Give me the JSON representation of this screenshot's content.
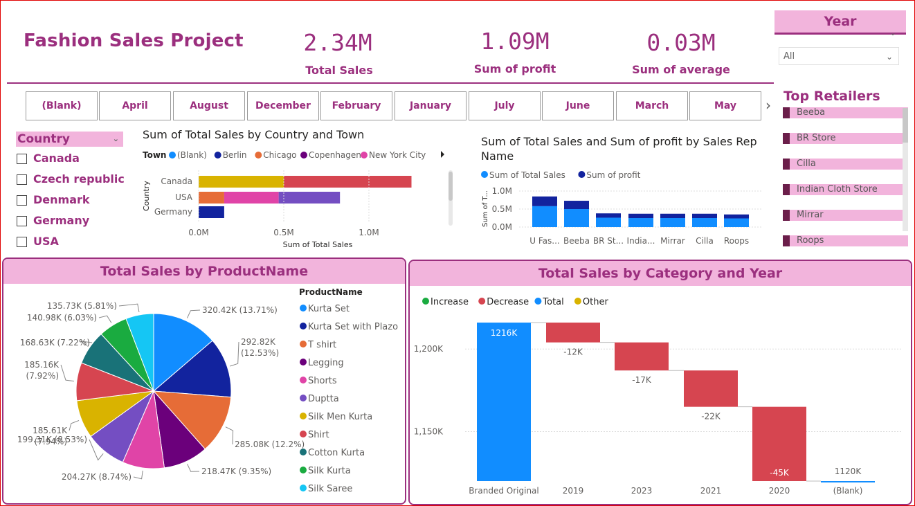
{
  "title": "Fashion Sales Project",
  "kpis": [
    {
      "value": "2.34M",
      "label": "Total Sales"
    },
    {
      "value": "1.09M",
      "label": "Sum of profit"
    },
    {
      "value": "0.03M",
      "label": "Sum of average"
    }
  ],
  "year_filter": {
    "label": "Year",
    "selected": "All"
  },
  "months": [
    "(Blank)",
    "April",
    "August",
    "December",
    "February",
    "January",
    "July",
    "June",
    "March",
    "May"
  ],
  "top_retailers": {
    "label": "Top Retailers",
    "items": [
      "Beeba",
      "BR Store",
      "Cilla",
      "Indian Cloth Store",
      "Mirrar",
      "Roops"
    ]
  },
  "country_filter": {
    "label": "Country",
    "items": [
      "Canada",
      "Czech republic",
      "Denmark",
      "Germany",
      "USA"
    ]
  },
  "colors": {
    "accent": "#9b2f7e",
    "header_bg": "#f2b4dc",
    "blue": "#118dff",
    "dark_blue": "#12239e",
    "orange": "#e66c37",
    "purple": "#6b007b",
    "pink": "#e044a7",
    "violet": "#744ec2",
    "gold": "#d9b300",
    "red": "#d64550",
    "teal": "#197278",
    "green": "#1aab40",
    "cyan": "#15c6f4"
  },
  "chart_data": [
    {
      "type": "bar",
      "orientation": "horizontal",
      "stacked": true,
      "title": "Sum of Total Sales by Country and Town",
      "legend_title": "Town",
      "legend": [
        {
          "name": "(Blank)",
          "color": "#118dff"
        },
        {
          "name": "Berlin",
          "color": "#12239e"
        },
        {
          "name": "Chicago",
          "color": "#e66c37"
        },
        {
          "name": "Copenhagen",
          "color": "#6b007b"
        },
        {
          "name": "New York City",
          "color": "#e044a7"
        }
      ],
      "categories": [
        "Canada",
        "USA",
        "Germany"
      ],
      "segments": [
        [
          {
            "value": 0.5,
            "color": "#d9b300"
          },
          {
            "value": 0.75,
            "color": "#d64550"
          }
        ],
        [
          {
            "value": 0.15,
            "color": "#e66c37"
          },
          {
            "value": 0.32,
            "color": "#e044a7"
          },
          {
            "value": 0.36,
            "color": "#744ec2"
          }
        ],
        [
          {
            "value": 0.15,
            "color": "#12239e"
          }
        ]
      ],
      "xlabel": "Sum of Total Sales",
      "ylabel": "Country",
      "xticks": [
        "0.0M",
        "0.5M",
        "1.0M"
      ],
      "xlim": [
        0,
        1.3
      ]
    },
    {
      "type": "bar",
      "stacked": true,
      "title": "Sum of Total Sales and Sum of profit by Sales Rep Name",
      "legend": [
        {
          "name": "Sum of Total Sales",
          "color": "#118dff"
        },
        {
          "name": "Sum of profit",
          "color": "#12239e"
        }
      ],
      "categories": [
        "U Fas...",
        "Beeba",
        "BR St...",
        "India...",
        "Mirrar",
        "Cilla",
        "Roops"
      ],
      "series": [
        {
          "name": "Sum of Total Sales",
          "values": [
            0.58,
            0.5,
            0.26,
            0.25,
            0.25,
            0.25,
            0.24
          ]
        },
        {
          "name": "Sum of profit",
          "values": [
            0.27,
            0.23,
            0.12,
            0.12,
            0.12,
            0.12,
            0.11
          ]
        }
      ],
      "ylabel": "Sum of T...",
      "yticks": [
        "0.0M",
        "0.5M",
        "1.0M"
      ],
      "ylim": [
        0,
        1.0
      ]
    },
    {
      "type": "pie",
      "title": "Total Sales by ProductName",
      "legend_title": "ProductName",
      "slices": [
        {
          "name": "Kurta Set",
          "value": 320.42,
          "label": "320.42K (13.71%)",
          "color": "#118dff"
        },
        {
          "name": "Kurta Set with Plazo",
          "value": 292.82,
          "label": "292.82K (12.53%)",
          "color": "#12239e"
        },
        {
          "name": "T shirt",
          "value": 285.08,
          "label": "285.08K (12.2%)",
          "color": "#e66c37"
        },
        {
          "name": "Legging",
          "value": 218.47,
          "label": "218.47K (9.35%)",
          "color": "#6b007b"
        },
        {
          "name": "Shorts",
          "value": 204.27,
          "label": "204.27K (8.74%)",
          "color": "#e044a7"
        },
        {
          "name": "Duptta",
          "value": 199.31,
          "label": "199.31K (8.53%)",
          "color": "#744ec2"
        },
        {
          "name": "Silk Men Kurta",
          "value": 185.61,
          "label": "185.61K (7.94%)",
          "color": "#d9b300"
        },
        {
          "name": "Shirt",
          "value": 185.16,
          "label": "185.16K (7.92%)",
          "color": "#d64550"
        },
        {
          "name": "Cotton Kurta",
          "value": 168.63,
          "label": "168.63K (7.22%)",
          "color": "#197278"
        },
        {
          "name": "Silk Kurta",
          "value": 140.98,
          "label": "140.98K (6.03%)",
          "color": "#1aab40"
        },
        {
          "name": "Silk Saree",
          "value": 135.73,
          "label": "135.73K (5.81%)",
          "color": "#15c6f4"
        }
      ]
    },
    {
      "type": "waterfall",
      "title": "Total Sales by Category and Year",
      "legend": [
        {
          "name": "Increase",
          "color": "#1aab40"
        },
        {
          "name": "Decrease",
          "color": "#d64550"
        },
        {
          "name": "Total",
          "color": "#118dff"
        },
        {
          "name": "Other",
          "color": "#d9b300"
        }
      ],
      "categories": [
        "Branded Original",
        "2019",
        "2023",
        "2021",
        "2020",
        "(Blank)"
      ],
      "values": [
        1216,
        -12,
        -17,
        -22,
        -45,
        1120
      ],
      "labels": [
        "1216K",
        "-12K",
        "-17K",
        "-22K",
        "-45K",
        "1120K"
      ],
      "kinds": [
        "total",
        "decrease",
        "decrease",
        "decrease",
        "decrease",
        "total"
      ],
      "yticks": [
        {
          "value": 1200,
          "label": "1,200K"
        },
        {
          "value": 1150,
          "label": "1,150K"
        }
      ],
      "ylim": [
        1120,
        1220
      ]
    }
  ]
}
